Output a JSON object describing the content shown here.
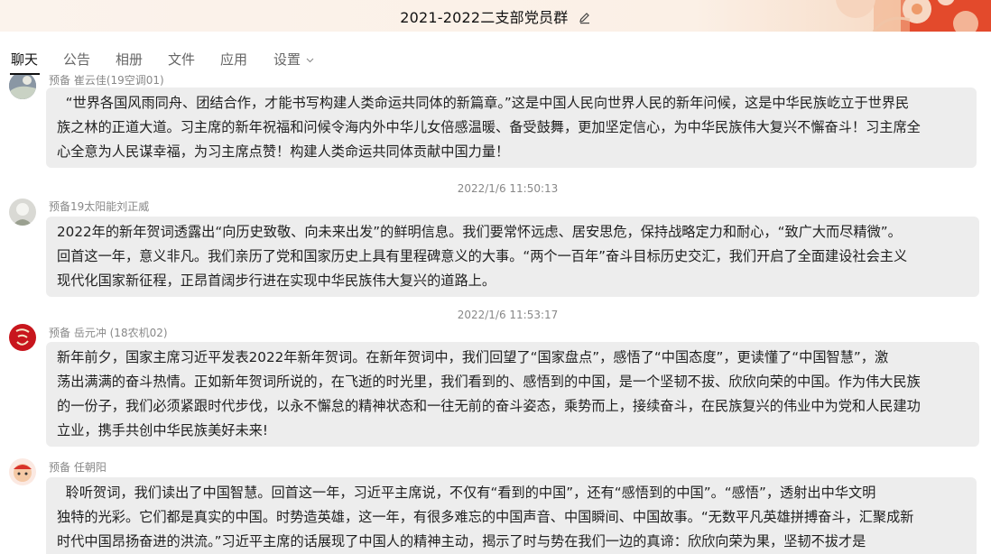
{
  "window": {
    "title": "2021-2022二支部党员群"
  },
  "tabs": [
    {
      "label": "聊天"
    },
    {
      "label": "公告"
    },
    {
      "label": "相册"
    },
    {
      "label": "文件"
    },
    {
      "label": "应用"
    },
    {
      "label": "设置"
    }
  ],
  "messages": [
    {
      "sender": "预备 崔云佳(19空调01)",
      "lines": [
        "  “世界各国风雨同舟、团结合作，才能书写构建人类命运共同体的新篇章。”这是中国人民向世界人民的新年问候，这是中华民族屹立于世界民",
        "族之林的正道大道。习主席的新年祝福和问候令海内外中华儿女倍感温暖、备受鼓舞，更加坚定信心，为中华民族伟大复兴不懈奋斗！习主席全",
        "心全意为人民谋幸福，为习主席点赞！构建人类命运共同体贡献中国力量！"
      ]
    },
    {
      "timestamp": "2022/1/6 11:50:13",
      "sender": "预备19太阳能刘正威",
      "lines": [
        "2022年的新年贺词透露出“向历史致敬、向未来出发”的鲜明信息。我们要常怀远虑、居安思危，保持战略定力和耐心，“致广大而尽精微”。",
        "回首这一年，意义非凡。我们亲历了党和国家历史上具有里程碑意义的大事。“两个一百年”奋斗目标历史交汇，我们开启了全面建设社会主义",
        "现代化国家新征程，正昂首阔步行进在实现中华民族伟大复兴的道路上。"
      ]
    },
    {
      "timestamp": "2022/1/6 11:53:17",
      "sender": "预备 岳元冲 (18农机02)",
      "lines": [
        "新年前夕，国家主席习近平发表2022年新年贺词。在新年贺词中，我们回望了“国家盘点”，感悟了“中国态度”，更读懂了“中国智慧”，激",
        "荡出满满的奋斗热情。正如新年贺词所说的，在飞逝的时光里，我们看到的、感悟到的中国，是一个坚韧不拔、欣欣向荣的中国。作为伟大民族",
        "的一份子，我们必须紧跟时代步伐，以永不懈怠的精神状态和一往无前的奋斗姿态，乘势而上，接续奋斗，在民族复兴的伟业中为党和人民建功",
        "立业，携手共创中华民族美好未来!"
      ]
    },
    {
      "sender": "预备 任朝阳",
      "lines": [
        "  聆听贺词，我们读出了中国智慧。回首这一年，习近平主席说，不仅有“看到的中国”，还有“感悟到的中国”。“感悟”，透射出中华文明",
        "独特的光彩。它们都是真实的中国。时势造英雄，这一年，有很多难忘的中国声音、中国瞬间、中国故事。“无数平凡英雄拼搏奋斗，汇聚成新",
        "时代中国昂扬奋进的洪流。”习近平主席的话展现了中国人的精神主动，揭示了时与势在我们一边的真谛：欣欣向荣为果，坚韧不拔才是"
      ]
    }
  ],
  "colors": {
    "bubble": "#ededed",
    "muted_text": "#888888",
    "header_accent": "#e0482c"
  }
}
